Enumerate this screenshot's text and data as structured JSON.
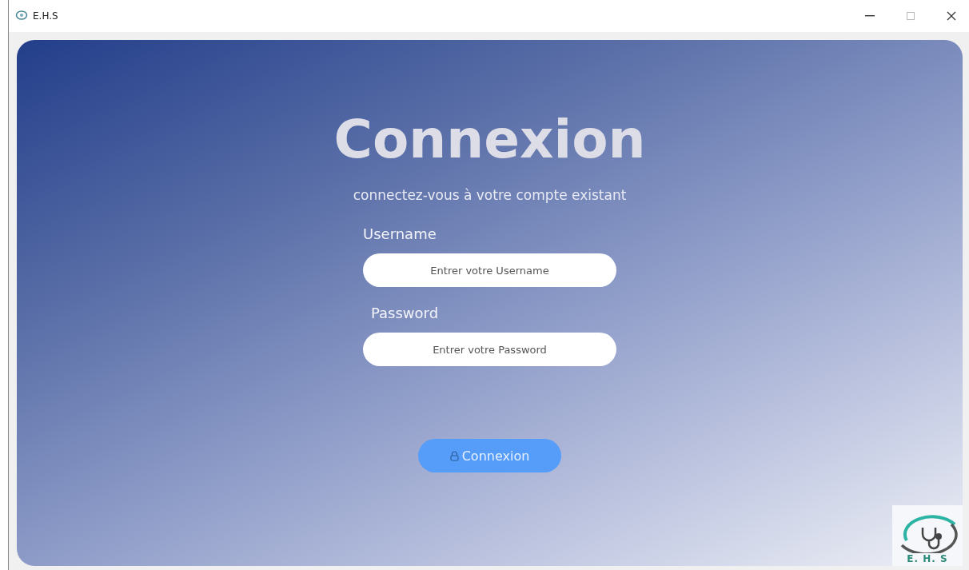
{
  "window": {
    "title": "E.H.S"
  },
  "login": {
    "heading": "Connexion",
    "subtitle": "connectez-vous à votre compte existant",
    "fields": [
      {
        "label": "Username",
        "placeholder": "Entrer votre Username"
      },
      {
        "label": "Password",
        "placeholder": "Entrer votre Password"
      }
    ],
    "button": "Connexion"
  },
  "logo": {
    "text": "E. H. S"
  }
}
